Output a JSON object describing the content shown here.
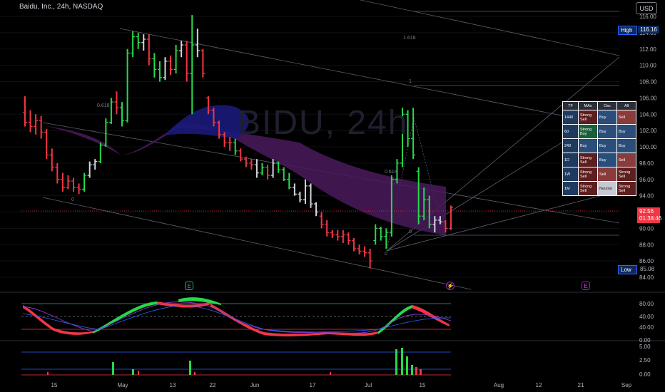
{
  "header": {
    "title": "Baidu, Inc., 24h, NASDAQ",
    "currency_button": "USD",
    "watermark": "BIDU, 24h"
  },
  "price_axis": {
    "labels": [
      "116.00",
      "114.00",
      "112.00",
      "110.00",
      "108.00",
      "106.00",
      "104.00",
      "102.00",
      "100.00",
      "98.00",
      "96.00",
      "94.00",
      "92.00",
      "90.00",
      "88.00",
      "86.00",
      "84.00"
    ],
    "high_label": "High",
    "high_value": "116.16",
    "low_label": "Low",
    "low_value": "85.08",
    "current_price": "92.56",
    "countdown": "01:38:46"
  },
  "oscillator_axis": {
    "labels": [
      "80.00",
      "60.00",
      "40.00",
      "20.00",
      "0.00"
    ]
  },
  "volume_axis": {
    "labels": [
      "5.00",
      "2.50",
      "0.00"
    ]
  },
  "time_axis": {
    "labels": [
      "15",
      "May",
      "13",
      "22",
      "Jun",
      "17",
      "Jul",
      "15",
      "Aug",
      "12",
      "21",
      "Sep"
    ]
  },
  "fib_labels": {
    "f1618": "1.618",
    "f1": "1",
    "f0618a": "0.618",
    "f0a": "0",
    "f0618b": "0.618",
    "f0b": "0",
    "f0c": "0"
  },
  "events": {
    "earnings1": "E",
    "dividend": "⚡",
    "earnings2": "E"
  },
  "tf_table": {
    "headers": [
      "TF",
      "MAs",
      "Osc",
      "All"
    ],
    "rows": [
      {
        "tf": "1440",
        "mas": "Strong Sell",
        "osc": "Buy",
        "all": "Sell"
      },
      {
        "tf": "60",
        "mas": "Strong Buy",
        "osc": "Buy",
        "all": "Buy"
      },
      {
        "tf": "240",
        "mas": "Buy",
        "osc": "Buy",
        "all": "Buy"
      },
      {
        "tf": "1D",
        "mas": "Strong Sell",
        "osc": "Buy",
        "all": "Sell"
      },
      {
        "tf": "1W",
        "mas": "Strong Sell",
        "osc": "Sell",
        "all": "Strong Sell"
      },
      {
        "tf": "1M",
        "mas": "Strong Sell",
        "osc": "Neutral",
        "all": "Strong Sell"
      }
    ]
  },
  "colors": {
    "up": "#26d94a",
    "down": "#f23645",
    "neutral": "#d1d4dc",
    "accent": "#2962ff"
  },
  "chart_data": {
    "type": "ohlc",
    "title": "Baidu, Inc., 24h, NASDAQ",
    "ylim": [
      84,
      116.16
    ],
    "bars": [
      [
        104.2,
        106.2,
        102.5,
        103.0,
        "d"
      ],
      [
        103.0,
        104.5,
        101.8,
        102.5,
        "d"
      ],
      [
        102.5,
        104.0,
        101.5,
        103.2,
        "d"
      ],
      [
        103.2,
        103.8,
        101.0,
        101.8,
        "d"
      ],
      [
        101.8,
        102.2,
        98.5,
        99.0,
        "d"
      ],
      [
        99.0,
        99.8,
        97.0,
        97.5,
        "d"
      ],
      [
        97.5,
        98.0,
        95.5,
        96.0,
        "d"
      ],
      [
        96.0,
        96.8,
        94.5,
        95.0,
        "d"
      ],
      [
        95.0,
        96.5,
        94.8,
        95.8,
        "d"
      ],
      [
        95.8,
        96.2,
        94.5,
        95.0,
        "d"
      ],
      [
        95.0,
        95.5,
        94.2,
        94.8,
        "d"
      ],
      [
        94.8,
        96.8,
        94.5,
        96.5,
        "u"
      ],
      [
        96.5,
        98.2,
        96.2,
        97.8,
        "n"
      ],
      [
        97.8,
        98.5,
        97.2,
        98.2,
        "n"
      ],
      [
        98.2,
        100.5,
        98.0,
        100.2,
        "u"
      ],
      [
        100.2,
        103.5,
        100.0,
        103.0,
        "u"
      ],
      [
        103.0,
        106.0,
        102.8,
        105.5,
        "u"
      ],
      [
        105.5,
        106.8,
        104.0,
        104.8,
        "d"
      ],
      [
        104.8,
        105.5,
        102.5,
        103.2,
        "u"
      ],
      [
        103.2,
        112.0,
        103.0,
        111.5,
        "u"
      ],
      [
        111.5,
        114.2,
        111.0,
        113.5,
        "u"
      ],
      [
        113.5,
        114.0,
        112.0,
        112.8,
        "u"
      ],
      [
        112.8,
        113.8,
        111.8,
        113.2,
        "n"
      ],
      [
        113.2,
        113.8,
        110.0,
        110.8,
        "d"
      ],
      [
        110.8,
        111.5,
        108.5,
        109.5,
        "u"
      ],
      [
        109.5,
        110.5,
        108.0,
        108.5,
        "u"
      ],
      [
        108.5,
        111.0,
        108.2,
        110.5,
        "n"
      ],
      [
        110.5,
        111.2,
        108.8,
        109.5,
        "d"
      ],
      [
        109.5,
        112.5,
        109.0,
        111.8,
        "u"
      ],
      [
        111.8,
        113.0,
        111.0,
        112.5,
        "n"
      ],
      [
        112.5,
        113.0,
        108.0,
        109.0,
        "d"
      ],
      [
        109.0,
        116.16,
        104.0,
        112.5,
        "u"
      ],
      [
        112.5,
        114.5,
        111.0,
        111.8,
        "n"
      ],
      [
        111.8,
        112.0,
        108.5,
        109.0,
        "d"
      ],
      [
        106.0,
        106.2,
        104.0,
        104.5,
        "d"
      ],
      [
        104.5,
        104.8,
        102.5,
        103.0,
        "d"
      ],
      [
        103.0,
        103.2,
        101.0,
        101.5,
        "d"
      ],
      [
        101.5,
        101.8,
        100.0,
        100.5,
        "d"
      ],
      [
        100.5,
        101.2,
        99.5,
        100.5,
        "d"
      ],
      [
        100.5,
        101.0,
        99.0,
        99.5,
        "u"
      ],
      [
        99.5,
        99.8,
        98.2,
        98.5,
        "d"
      ],
      [
        98.5,
        98.8,
        97.5,
        98.0,
        "d"
      ],
      [
        98.0,
        98.5,
        97.2,
        97.8,
        "d"
      ],
      [
        97.8,
        98.5,
        96.2,
        96.8,
        "n"
      ],
      [
        96.8,
        98.0,
        96.5,
        97.5,
        "u"
      ],
      [
        97.5,
        97.8,
        96.0,
        96.5,
        "d"
      ],
      [
        96.5,
        98.5,
        96.2,
        98.0,
        "n"
      ],
      [
        98.0,
        98.2,
        96.8,
        97.2,
        "u"
      ],
      [
        97.2,
        97.5,
        95.8,
        96.0,
        "u"
      ],
      [
        96.0,
        96.8,
        94.8,
        95.0,
        "u"
      ],
      [
        95.0,
        95.5,
        94.0,
        94.2,
        "n"
      ],
      [
        94.2,
        94.5,
        93.2,
        93.5,
        "n"
      ],
      [
        93.5,
        96.0,
        93.0,
        95.2,
        "n"
      ],
      [
        95.2,
        95.5,
        92.5,
        93.0,
        "n"
      ],
      [
        93.0,
        93.2,
        91.5,
        92.0,
        "n"
      ],
      [
        91.5,
        92.0,
        90.0,
        90.5,
        "d"
      ],
      [
        90.5,
        91.0,
        89.0,
        89.5,
        "d"
      ],
      [
        89.5,
        89.8,
        88.8,
        89.2,
        "d"
      ],
      [
        89.2,
        89.8,
        88.5,
        89.0,
        "d"
      ],
      [
        89.0,
        89.8,
        88.2,
        89.2,
        "d"
      ],
      [
        89.2,
        89.5,
        88.0,
        88.5,
        "d"
      ],
      [
        88.5,
        88.8,
        87.2,
        87.5,
        "d"
      ],
      [
        87.5,
        88.0,
        86.8,
        87.2,
        "d"
      ],
      [
        87.2,
        87.8,
        86.5,
        87.0,
        "d"
      ],
      [
        87.0,
        87.5,
        85.08,
        86.0,
        "d"
      ],
      [
        88.5,
        90.5,
        88.0,
        90.0,
        "u"
      ],
      [
        90.0,
        90.2,
        88.5,
        89.0,
        "u"
      ],
      [
        89.0,
        90.0,
        87.5,
        89.5,
        "u"
      ],
      [
        89.5,
        96.5,
        89.0,
        96.0,
        "u"
      ],
      [
        96.0,
        98.5,
        95.5,
        98.0,
        "u"
      ],
      [
        98.0,
        104.8,
        97.5,
        104.0,
        "u"
      ],
      [
        104.0,
        104.5,
        100.0,
        101.0,
        "u"
      ],
      [
        101.0,
        104.8,
        98.5,
        99.0,
        "u"
      ],
      [
        97.0,
        97.5,
        90.5,
        91.5,
        "u"
      ],
      [
        91.5,
        95.0,
        91.0,
        93.5,
        "u"
      ],
      [
        93.5,
        94.0,
        90.0,
        90.5,
        "u"
      ],
      [
        90.5,
        91.5,
        89.5,
        91.0,
        "n"
      ],
      [
        91.0,
        91.5,
        90.5,
        90.8,
        "n"
      ],
      [
        90.8,
        91.0,
        89.5,
        90.0,
        "d"
      ],
      [
        90.0,
        92.8,
        89.8,
        92.56,
        "d"
      ]
    ],
    "oscillator": {
      "overbought": 80,
      "oversold": 20,
      "mid": 50,
      "range": [
        0,
        100
      ]
    },
    "volume": {
      "range": [
        0,
        5
      ],
      "lines": [
        0,
        1,
        5
      ]
    }
  }
}
